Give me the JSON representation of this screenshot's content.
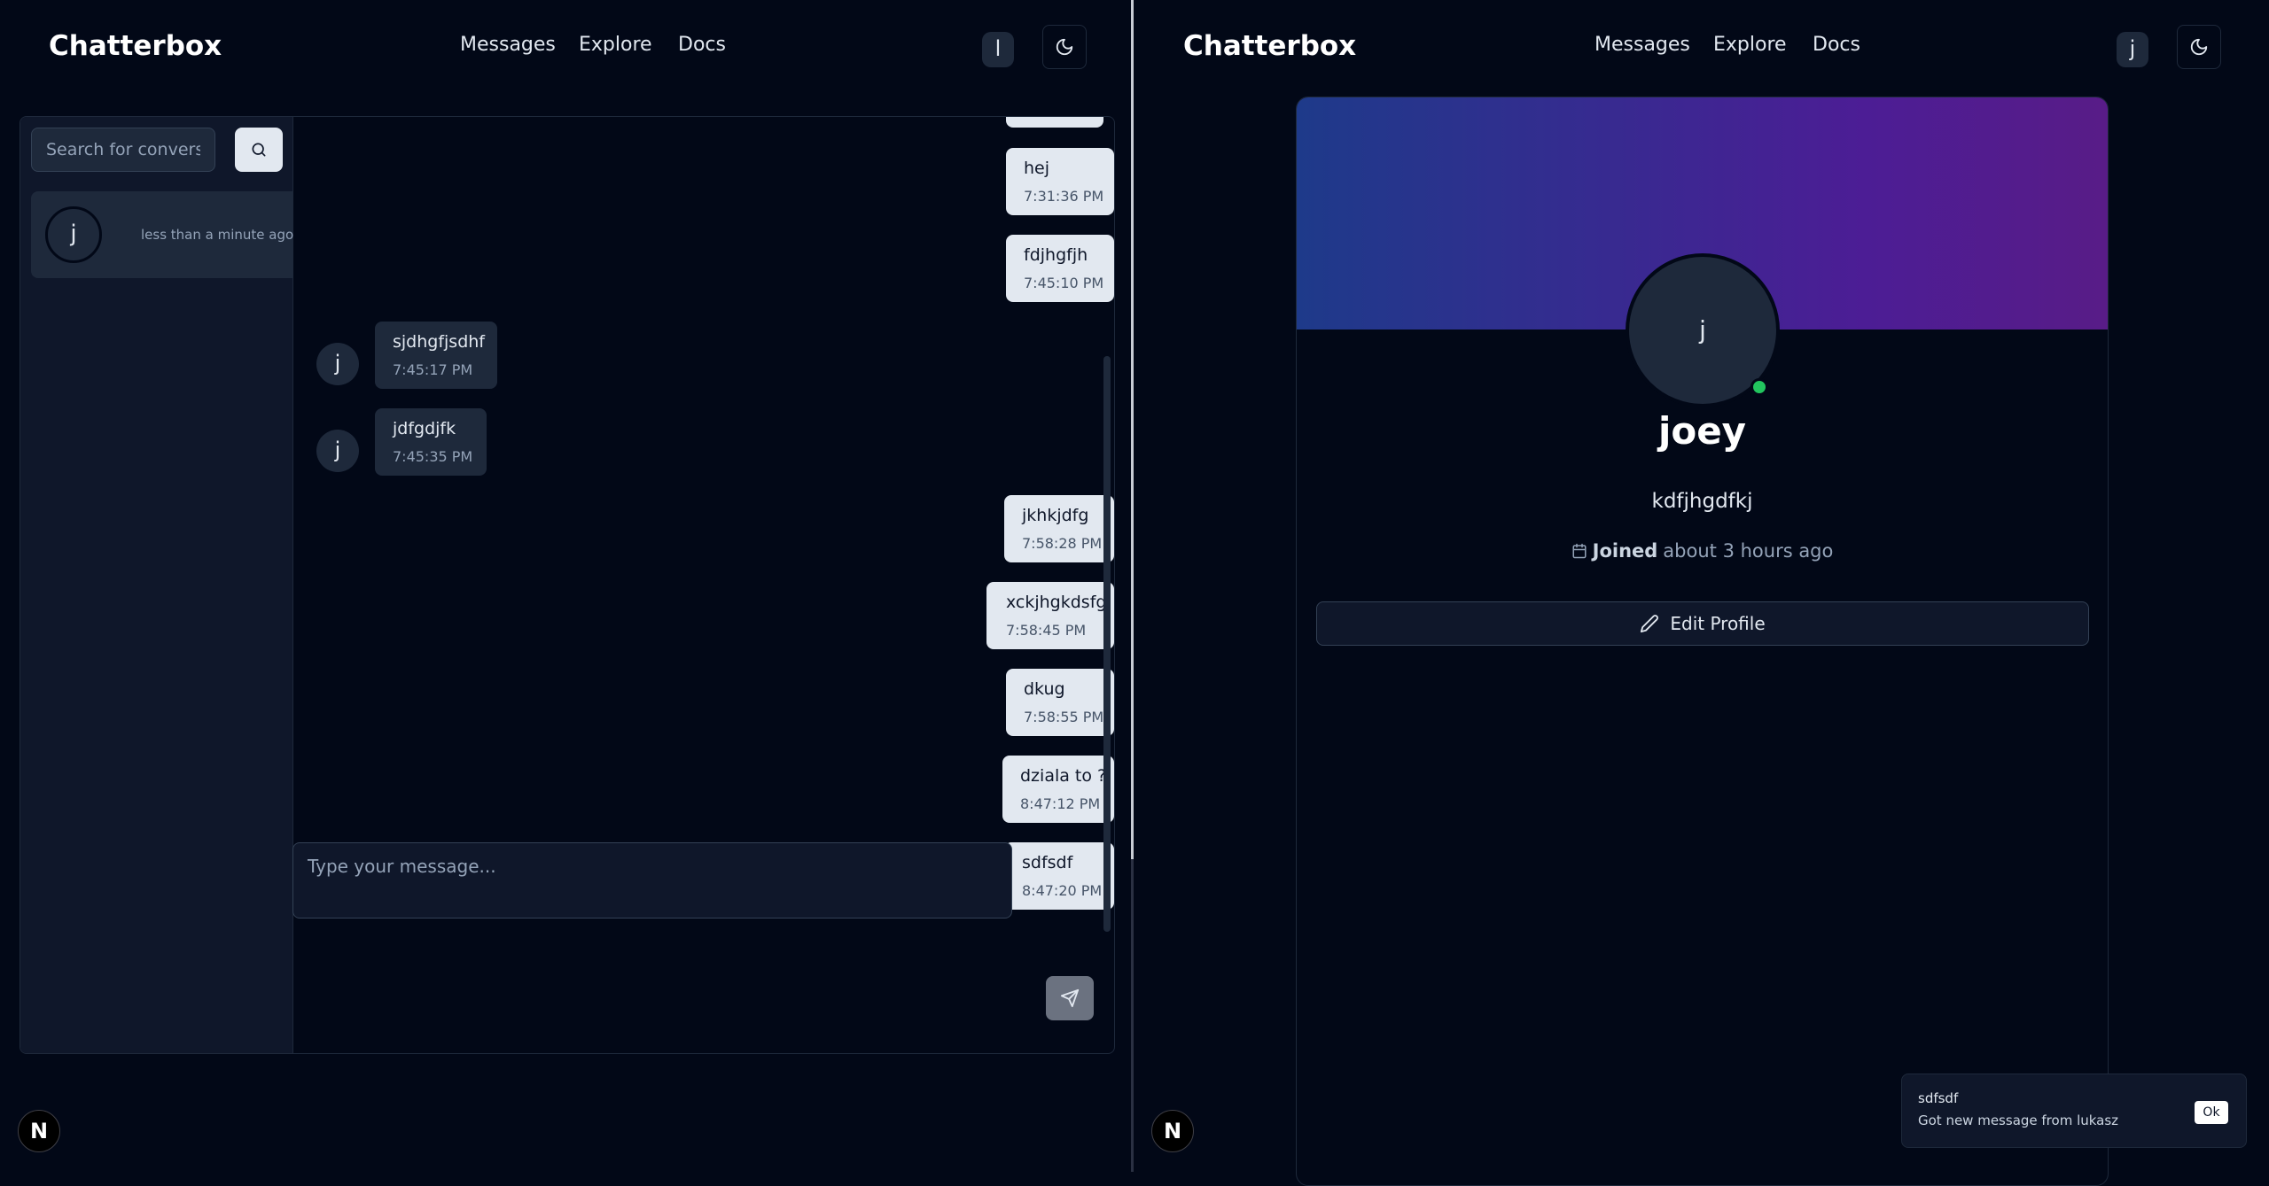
{
  "app": {
    "brand": "Chatterbox"
  },
  "nav": {
    "messages": "Messages",
    "explore": "Explore",
    "docs": "Docs"
  },
  "left": {
    "nav_avatar": "l",
    "search": {
      "placeholder": "Search for conversations..."
    },
    "conversation": {
      "avatar": "j",
      "time": "less than a minute ago"
    },
    "messages": [
      {
        "text": "hej",
        "time": "7:31:36 PM",
        "direction": "out"
      },
      {
        "text": "fdjhgfjh",
        "time": "7:45:10 PM",
        "direction": "out"
      },
      {
        "text": "sjdhgfjsdhf",
        "time": "7:45:17 PM",
        "direction": "in",
        "avatar": "j"
      },
      {
        "text": "jdfgdjfk",
        "time": "7:45:35 PM",
        "direction": "in",
        "avatar": "j"
      },
      {
        "text": "jkhkjdfg",
        "time": "7:58:28 PM",
        "direction": "out"
      },
      {
        "text": "xckjhgkdsfg",
        "time": "7:58:45 PM",
        "direction": "out"
      },
      {
        "text": "dkug",
        "time": "7:58:55 PM",
        "direction": "out"
      },
      {
        "text": "dziala to ?",
        "time": "8:47:12 PM",
        "direction": "out"
      },
      {
        "text": "sdfsdf",
        "time": "8:47:20 PM",
        "direction": "out"
      }
    ],
    "composer": {
      "placeholder": "Type your message..."
    }
  },
  "right": {
    "nav_avatar": "j",
    "profile": {
      "avatar": "j",
      "name": "joey",
      "bio": "kdfjhgdfkj",
      "joined_label": "Joined",
      "joined_value": "about 3 hours ago",
      "edit_label": "Edit Profile",
      "online_color": "#22c55e"
    },
    "toast": {
      "title": "sdfsdf",
      "description": "Got new message from lukasz",
      "ok_label": "Ok"
    }
  },
  "next_badge": "N",
  "icons": [
    "moon-icon",
    "search-icon",
    "send-icon",
    "calendar-icon",
    "pencil-icon"
  ],
  "colors": {
    "background": "#020817",
    "banner_start": "#1e3a8a",
    "banner_end": "#581c87"
  }
}
